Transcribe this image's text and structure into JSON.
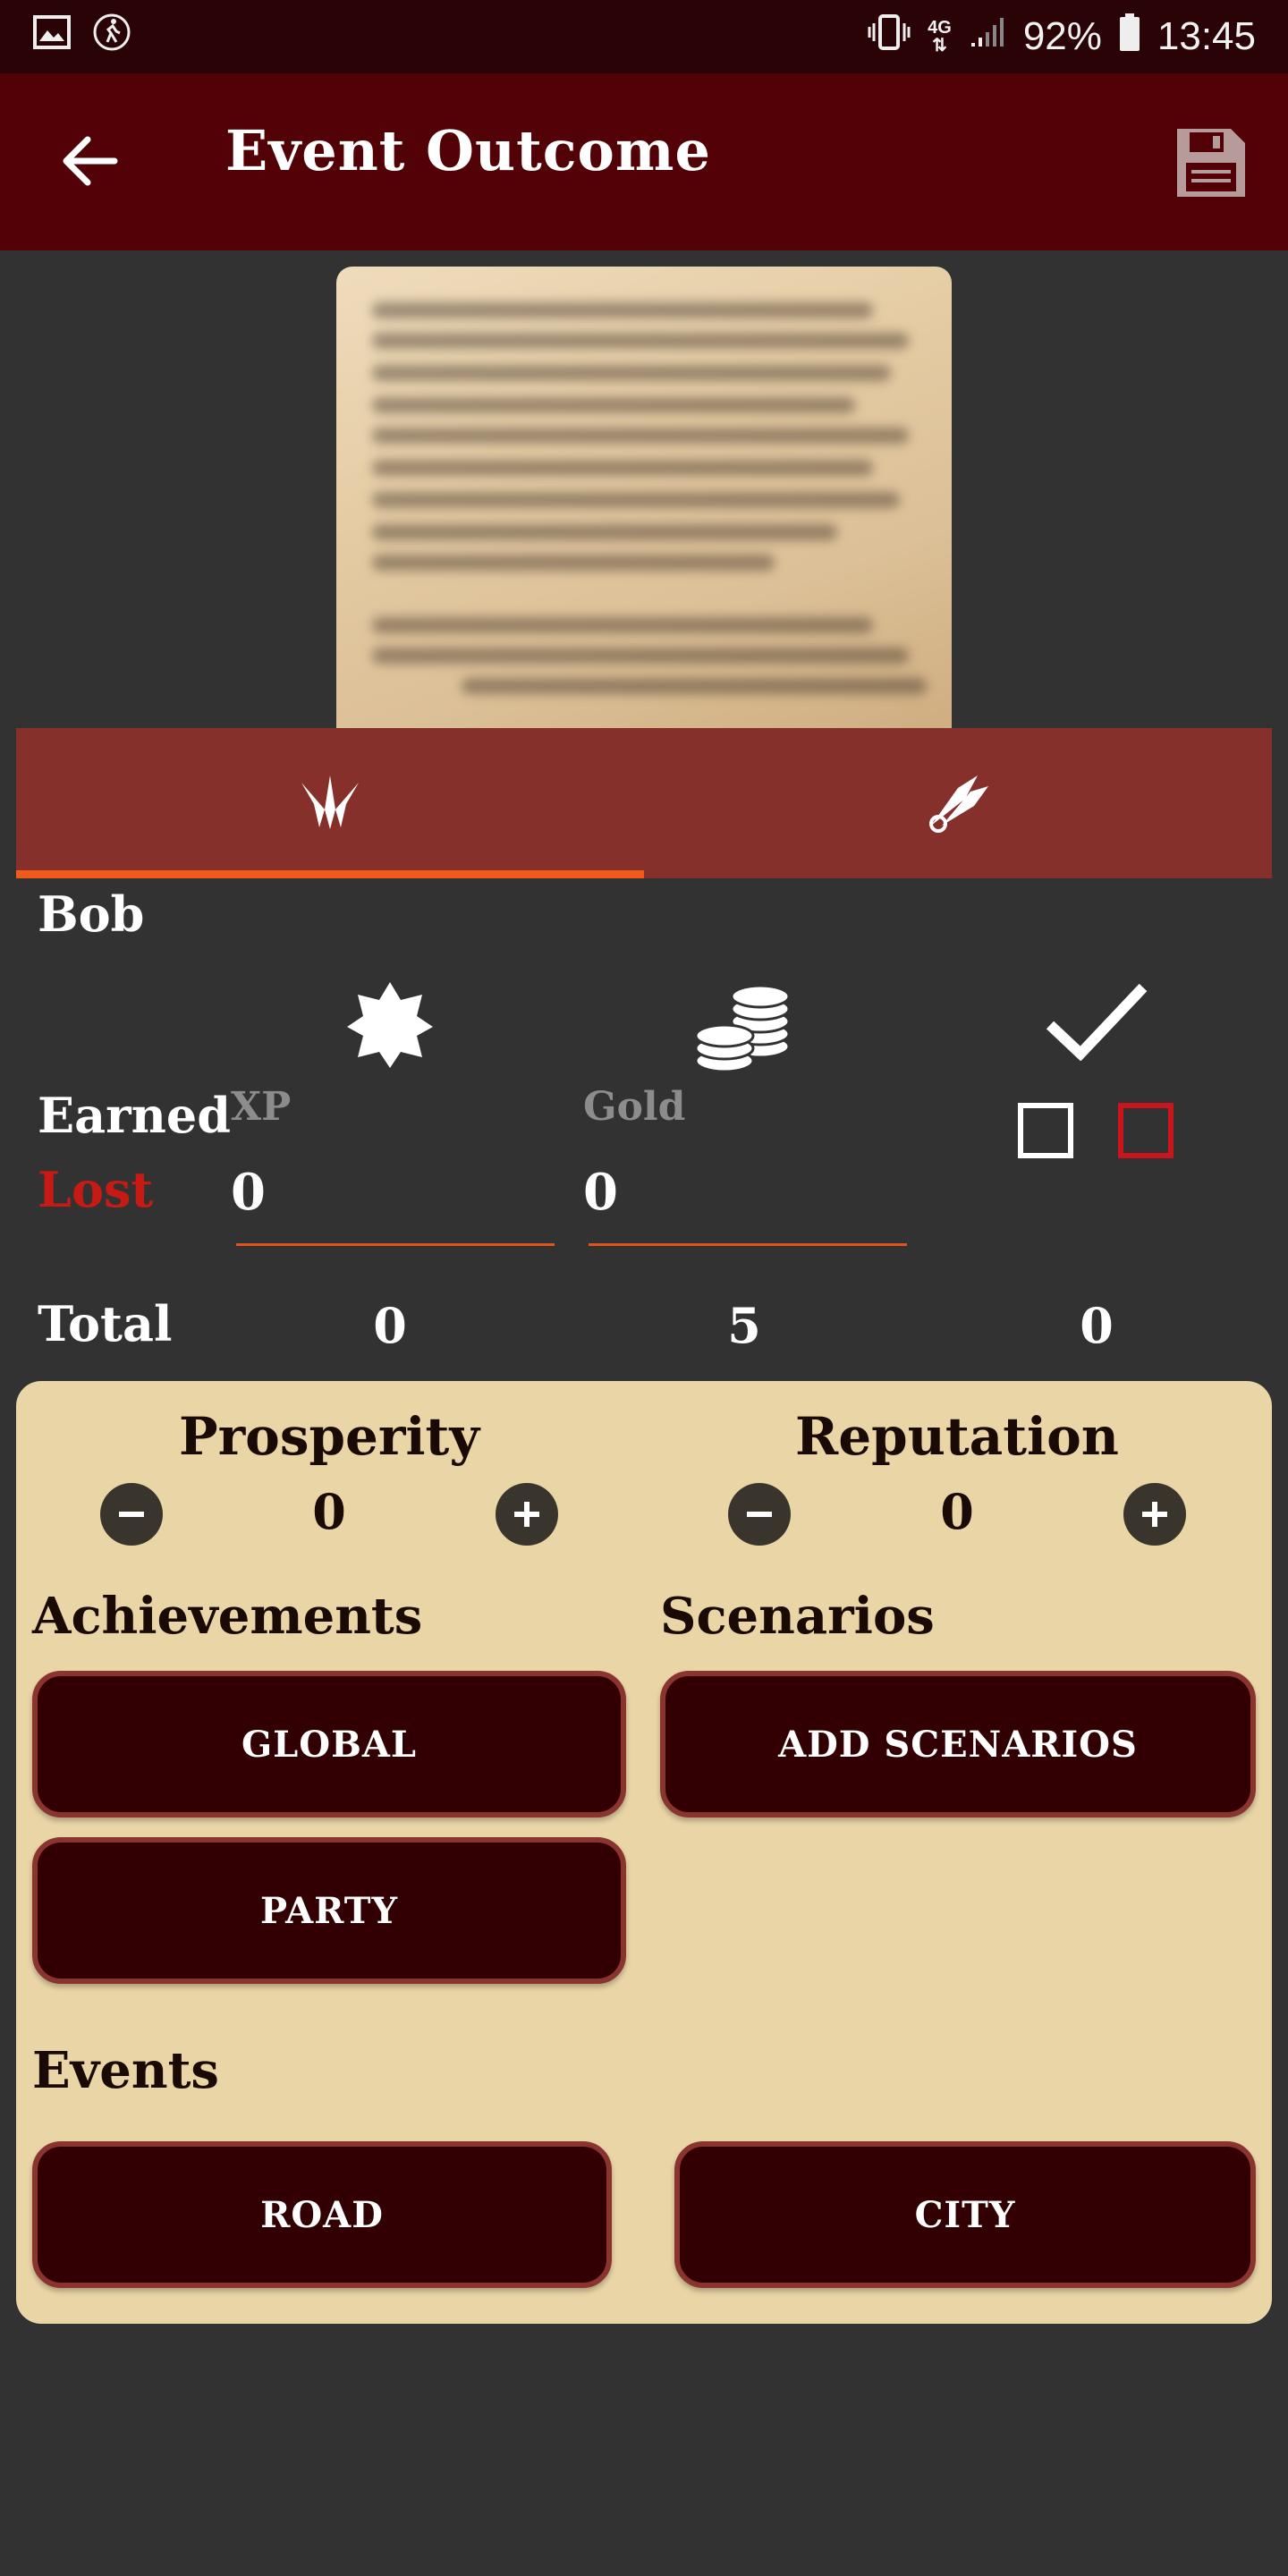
{
  "status_bar": {
    "battery": "92%",
    "time": "13:45",
    "network": "4G"
  },
  "header": {
    "title": "Event Outcome"
  },
  "character": {
    "name": "Bob"
  },
  "rewards": {
    "earned_label": "Earned",
    "lost_label": "Lost",
    "xp_label": "XP",
    "xp_value": "0",
    "gold_label": "Gold",
    "gold_value": "0"
  },
  "totals": {
    "label": "Total",
    "xp": "0",
    "gold": "5",
    "check": "0"
  },
  "party": {
    "prosperity_label": "Prosperity",
    "prosperity_value": "0",
    "reputation_label": "Reputation",
    "reputation_value": "0",
    "achievements_label": "Achievements",
    "scenarios_label": "Scenarios",
    "events_label": "Events",
    "global_button": "GLOBAL",
    "party_button": "PARTY",
    "add_scenarios_button": "ADD SCENARIOS",
    "road_button": "ROAD",
    "city_button": "CITY"
  },
  "colors": {
    "appbar": "#520206",
    "tabs": "#86302c",
    "accent": "#f25a1c",
    "lost": "#c81a14",
    "panel": "#ead5a6",
    "button": "#320003"
  }
}
